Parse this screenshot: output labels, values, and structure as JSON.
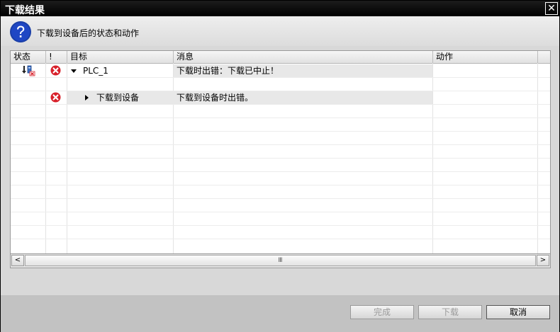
{
  "window": {
    "title": "下载结果",
    "close_label": "✕"
  },
  "header": {
    "message": "下载到设备后的状态和动作"
  },
  "table": {
    "columns": [
      "状态",
      "!",
      "目标",
      "消息",
      "动作"
    ],
    "rows": [
      {
        "target": "PLC_1",
        "message": "下载时出错：下载已中止！",
        "action": ""
      },
      {
        "target": "下载到设备",
        "message": "下载到设备时出错。",
        "action": ""
      }
    ]
  },
  "scrollbar": {
    "left_arrow": "<",
    "right_arrow": ">",
    "thumb_grip": "Ⅲ"
  },
  "buttons": {
    "finish": "完成",
    "download": "下载",
    "cancel": "取消"
  },
  "colors": {
    "accent": "#1a3fa8",
    "error": "#d8202a"
  }
}
